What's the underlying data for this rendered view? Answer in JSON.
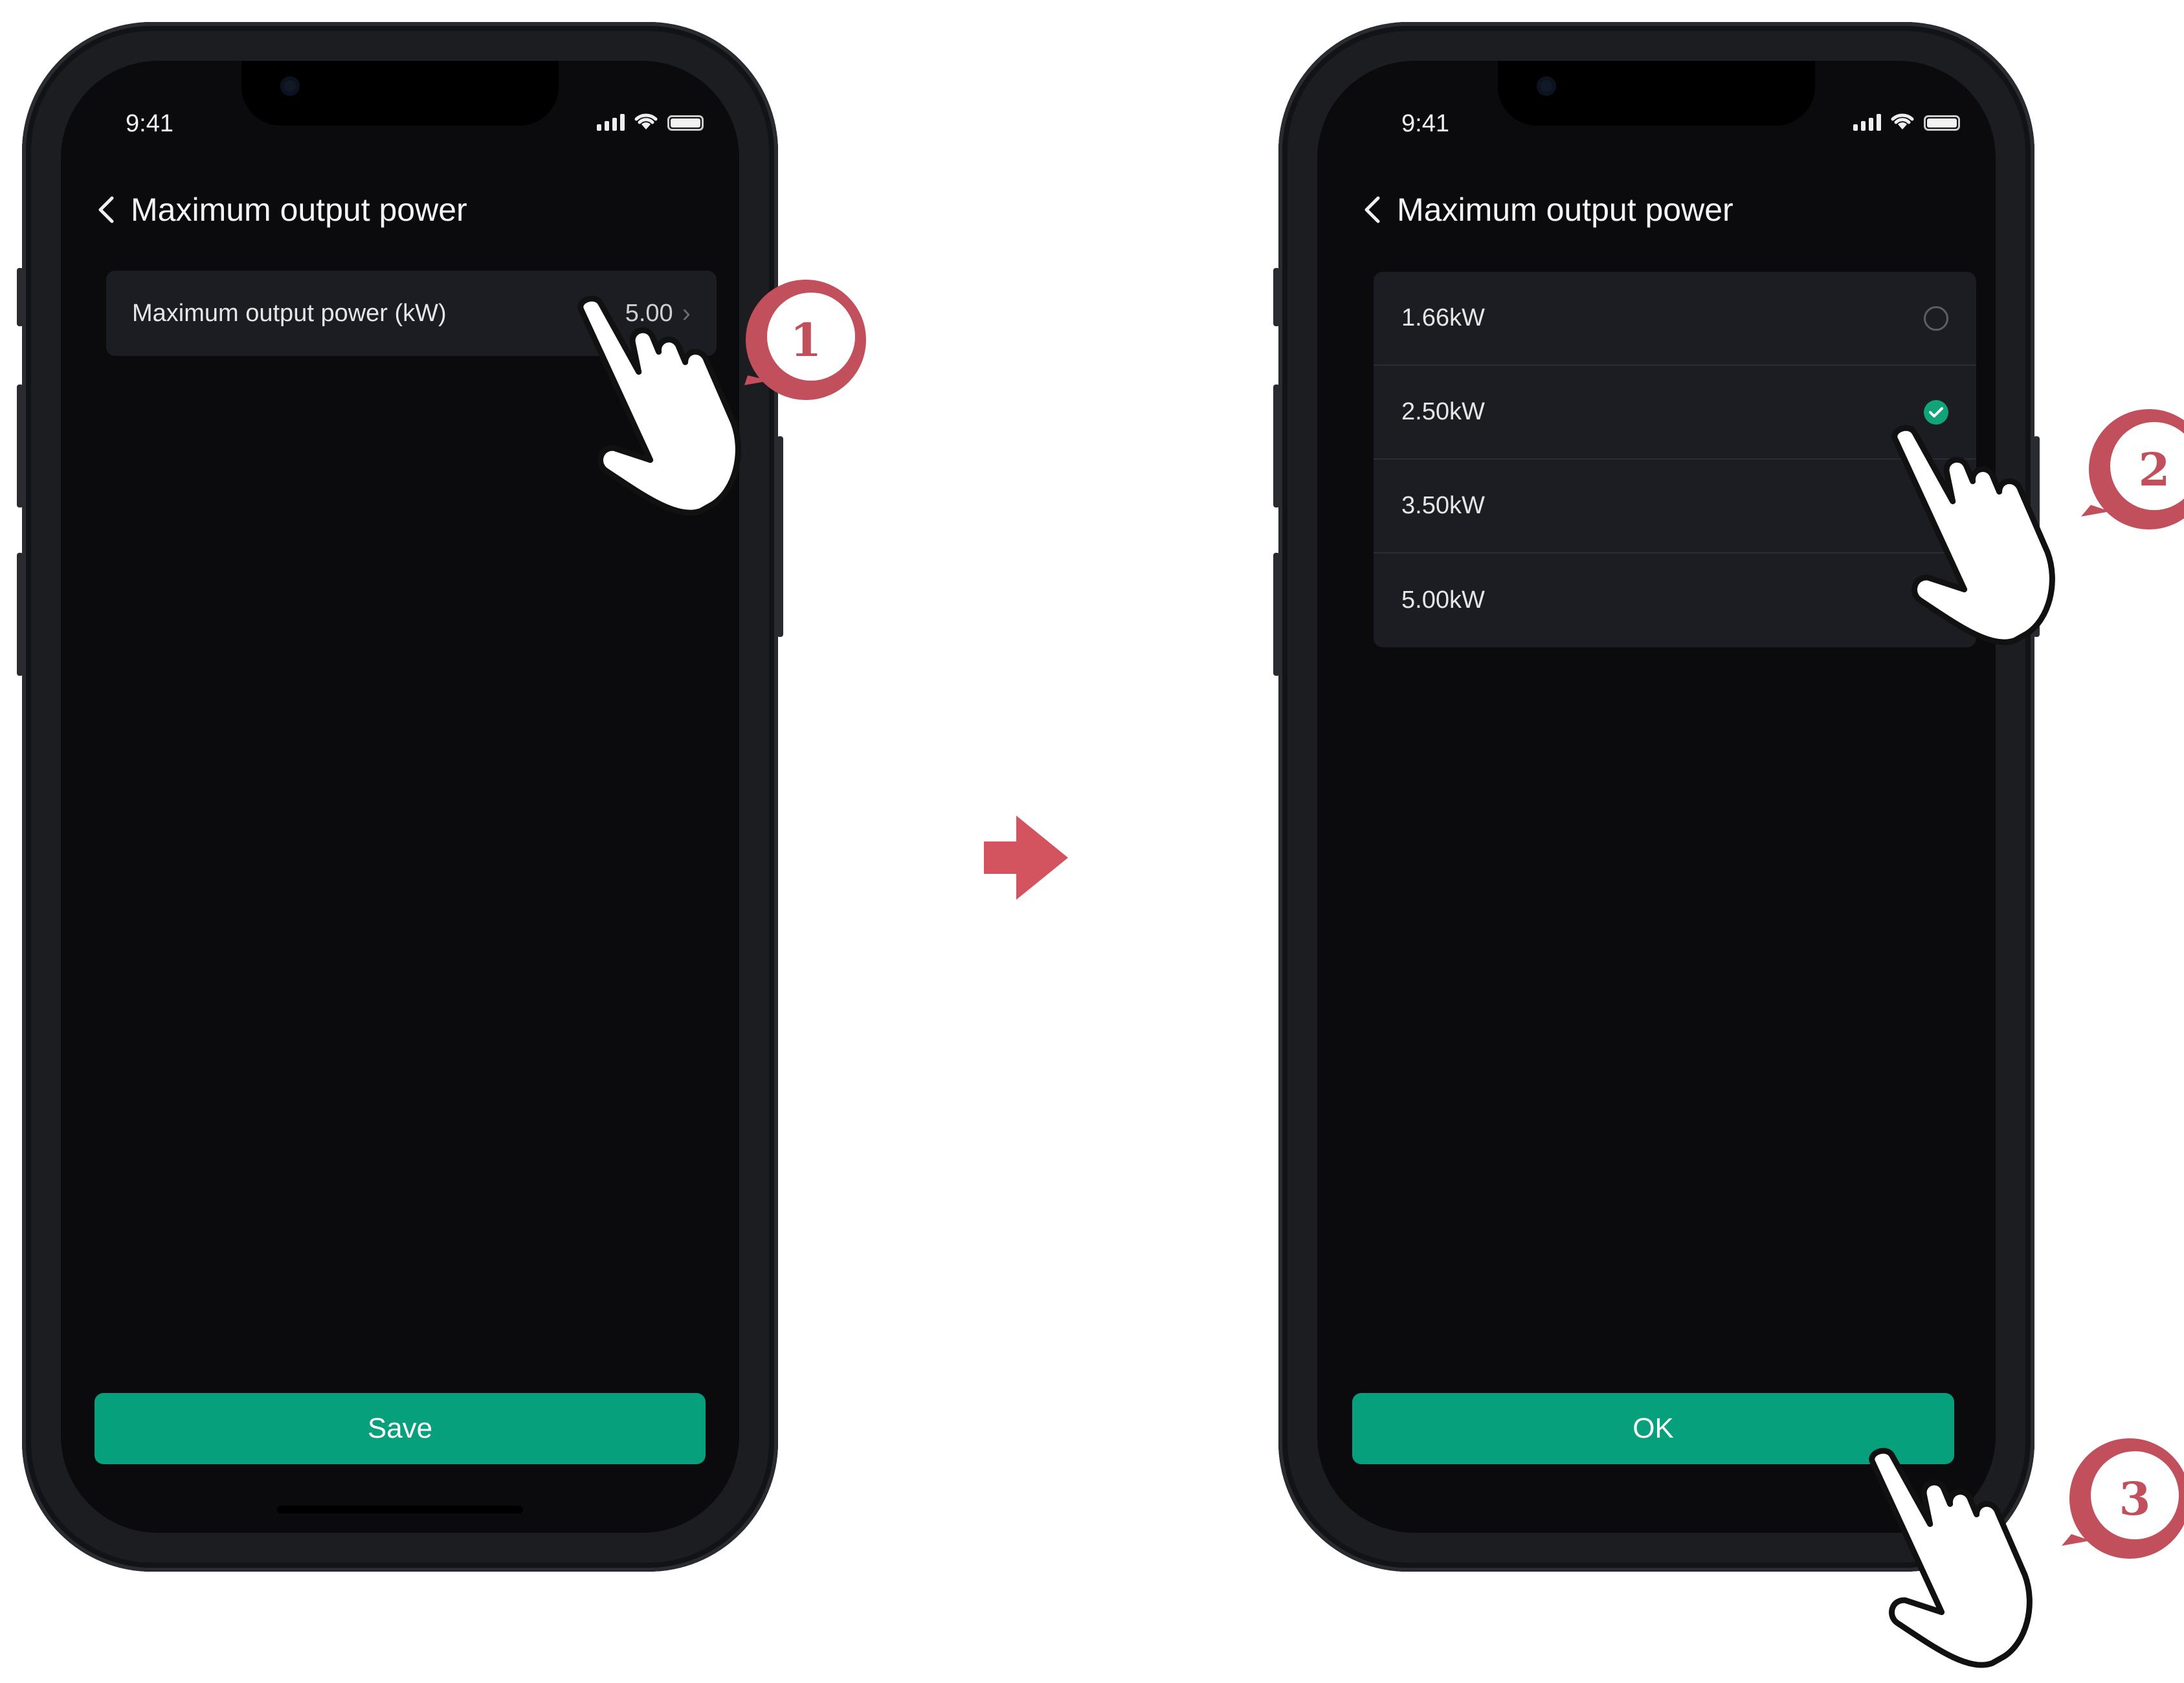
{
  "screen1": {
    "status_time": "9:41",
    "title": "Maximum output power",
    "row_label": "Maximum output power (kW)",
    "row_value": "5.00",
    "button": "Save"
  },
  "screen2": {
    "status_time": "9:41",
    "title": "Maximum output power",
    "options": [
      {
        "label": "1.66kW",
        "selected": false
      },
      {
        "label": "2.50kW",
        "selected": true
      },
      {
        "label": "3.50kW",
        "selected": false
      },
      {
        "label": "5.00kW",
        "selected": false
      }
    ],
    "button": "OK"
  },
  "steps": [
    "1",
    "2",
    "3"
  ],
  "colors": {
    "accent": "#07a07c",
    "badge": "#c24f5c",
    "arrow": "#d3545f",
    "background": "#0b0b0e"
  }
}
